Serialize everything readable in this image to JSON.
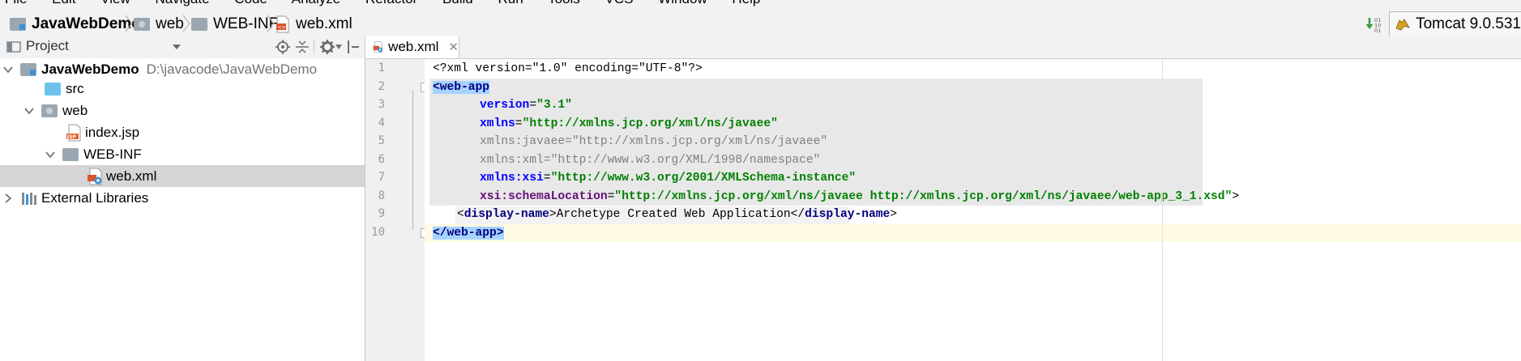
{
  "menu": [
    "File",
    "Edit",
    "View",
    "Navigate",
    "Code",
    "Analyze",
    "Refactor",
    "Build",
    "Run",
    "Tools",
    "VCS",
    "Window",
    "Help"
  ],
  "breadcrumb": {
    "project": "JavaWebDemo",
    "web": "web",
    "webinf": "WEB-INF",
    "file": "web.xml"
  },
  "run_config": {
    "label": "Tomcat 9.0.531"
  },
  "project_panel": {
    "title": "Project",
    "root": {
      "name": "JavaWebDemo",
      "path": "D:\\javacode\\JavaWebDemo"
    },
    "items": [
      "src",
      "web",
      "index.jsp",
      "WEB-INF",
      "web.xml"
    ],
    "external": "External Libraries"
  },
  "editor": {
    "tab": "web.xml",
    "line_numbers": [
      "1",
      "2",
      "3",
      "4",
      "5",
      "6",
      "7",
      "8",
      "9",
      "10"
    ],
    "lines": {
      "l1_decl": "<?xml version=\"1.0\" encoding=\"UTF-8\"?>",
      "l2_open": "<web-app",
      "l3_name": "version",
      "l3_val": "\"3.1\"",
      "l4_name": "xmlns",
      "l4_val": "\"http://xmlns.jcp.org/xml/ns/javaee\"",
      "l5_name": "xmlns:javaee",
      "l5_val": "\"http://xmlns.jcp.org/xml/ns/javaee\"",
      "l6_name": "xmlns:xml",
      "l6_val": "\"http://www.w3.org/XML/1998/namespace\"",
      "l7_name": "xmlns:xsi",
      "l7_val": "\"http://www.w3.org/2001/XMLSchema-instance\"",
      "l8_name": "xsi:schemaLocation",
      "l8_val": "\"http://xmlns.jcp.org/xml/ns/javaee http://xmlns.jcp.org/xml/ns/javaee/web-app_3_1.xsd\"",
      "l8_end": ">",
      "l9_tag": "display-name",
      "l9_text": "Archetype Created Web Application",
      "l10_close": "</web-app>"
    }
  },
  "colors": {
    "tag": "#000080",
    "attr": "#0000ff",
    "ns": "#660e7a",
    "value": "#008000",
    "selection": "#a6d2ff",
    "current_line": "#fffae3"
  }
}
